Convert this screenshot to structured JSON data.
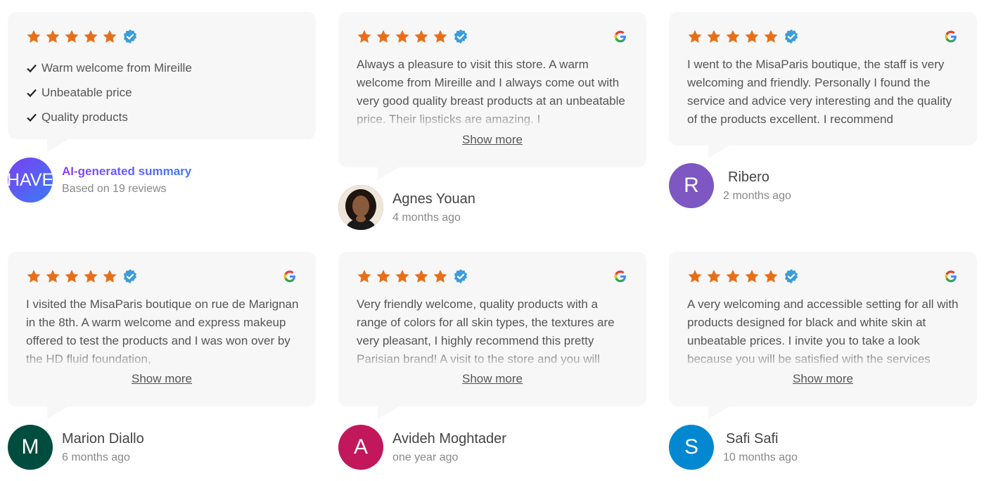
{
  "colors": {
    "card_bg": "#f7f7f7",
    "star": "#e86f1a",
    "verified": "#3b9ddb",
    "text": "#555555",
    "date": "#888888"
  },
  "summary": {
    "rating": 5,
    "points": [
      "Warm welcome from Mireille",
      "Unbeatable price",
      "Quality products"
    ],
    "avatar_text": "HAVE",
    "title": "AI-generated summary",
    "subtitle": "Based on 19 reviews"
  },
  "reviews": [
    {
      "rating": 5,
      "text": "Always a pleasure to visit this store. A warm welcome from Mireille and I always come out with very good quality breast products at an unbeatable price. Their lipsticks are amazing. I",
      "show_more": "Show more",
      "author": "Agnes Youan",
      "date": "4 months ago",
      "avatar_type": "photo"
    },
    {
      "rating": 5,
      "text": "I went to the MisaParis boutique, the staff is very welcoming and friendly. Personally I found the service and advice very interesting and the quality of the products excellent. I recommend",
      "author": "Ribero",
      "date": "2 months ago",
      "avatar_initial": "R",
      "avatar_color": "#7e57c2"
    },
    {
      "rating": 5,
      "text": "I visited the MisaParis boutique on rue de Marignan in the 8th. A warm welcome and express makeup offered to test the products and I was won over by the HD fluid foundation,",
      "show_more": "Show more",
      "author": "Marion Diallo",
      "date": "6 months ago",
      "avatar_initial": "M",
      "avatar_color": "#004d40"
    },
    {
      "rating": 5,
      "text": "Very friendly welcome, quality products with a range of colors for all skin types, the textures are very pleasant, I highly recommend this pretty Parisian brand! A visit to the store and you will",
      "show_more": "Show more",
      "author": "Avideh Moghtader",
      "date": "one year ago",
      "avatar_initial": "A",
      "avatar_color": "#c2185b"
    },
    {
      "rating": 5,
      "text": "A very welcoming and accessible setting for all with products designed for black and white skin at unbeatable prices. I invite you to take a look because you will be satisfied with the services",
      "show_more": "Show more",
      "author": "Safi Safi",
      "date": "10 months ago",
      "avatar_initial": "S",
      "avatar_color": "#0288d1"
    }
  ]
}
